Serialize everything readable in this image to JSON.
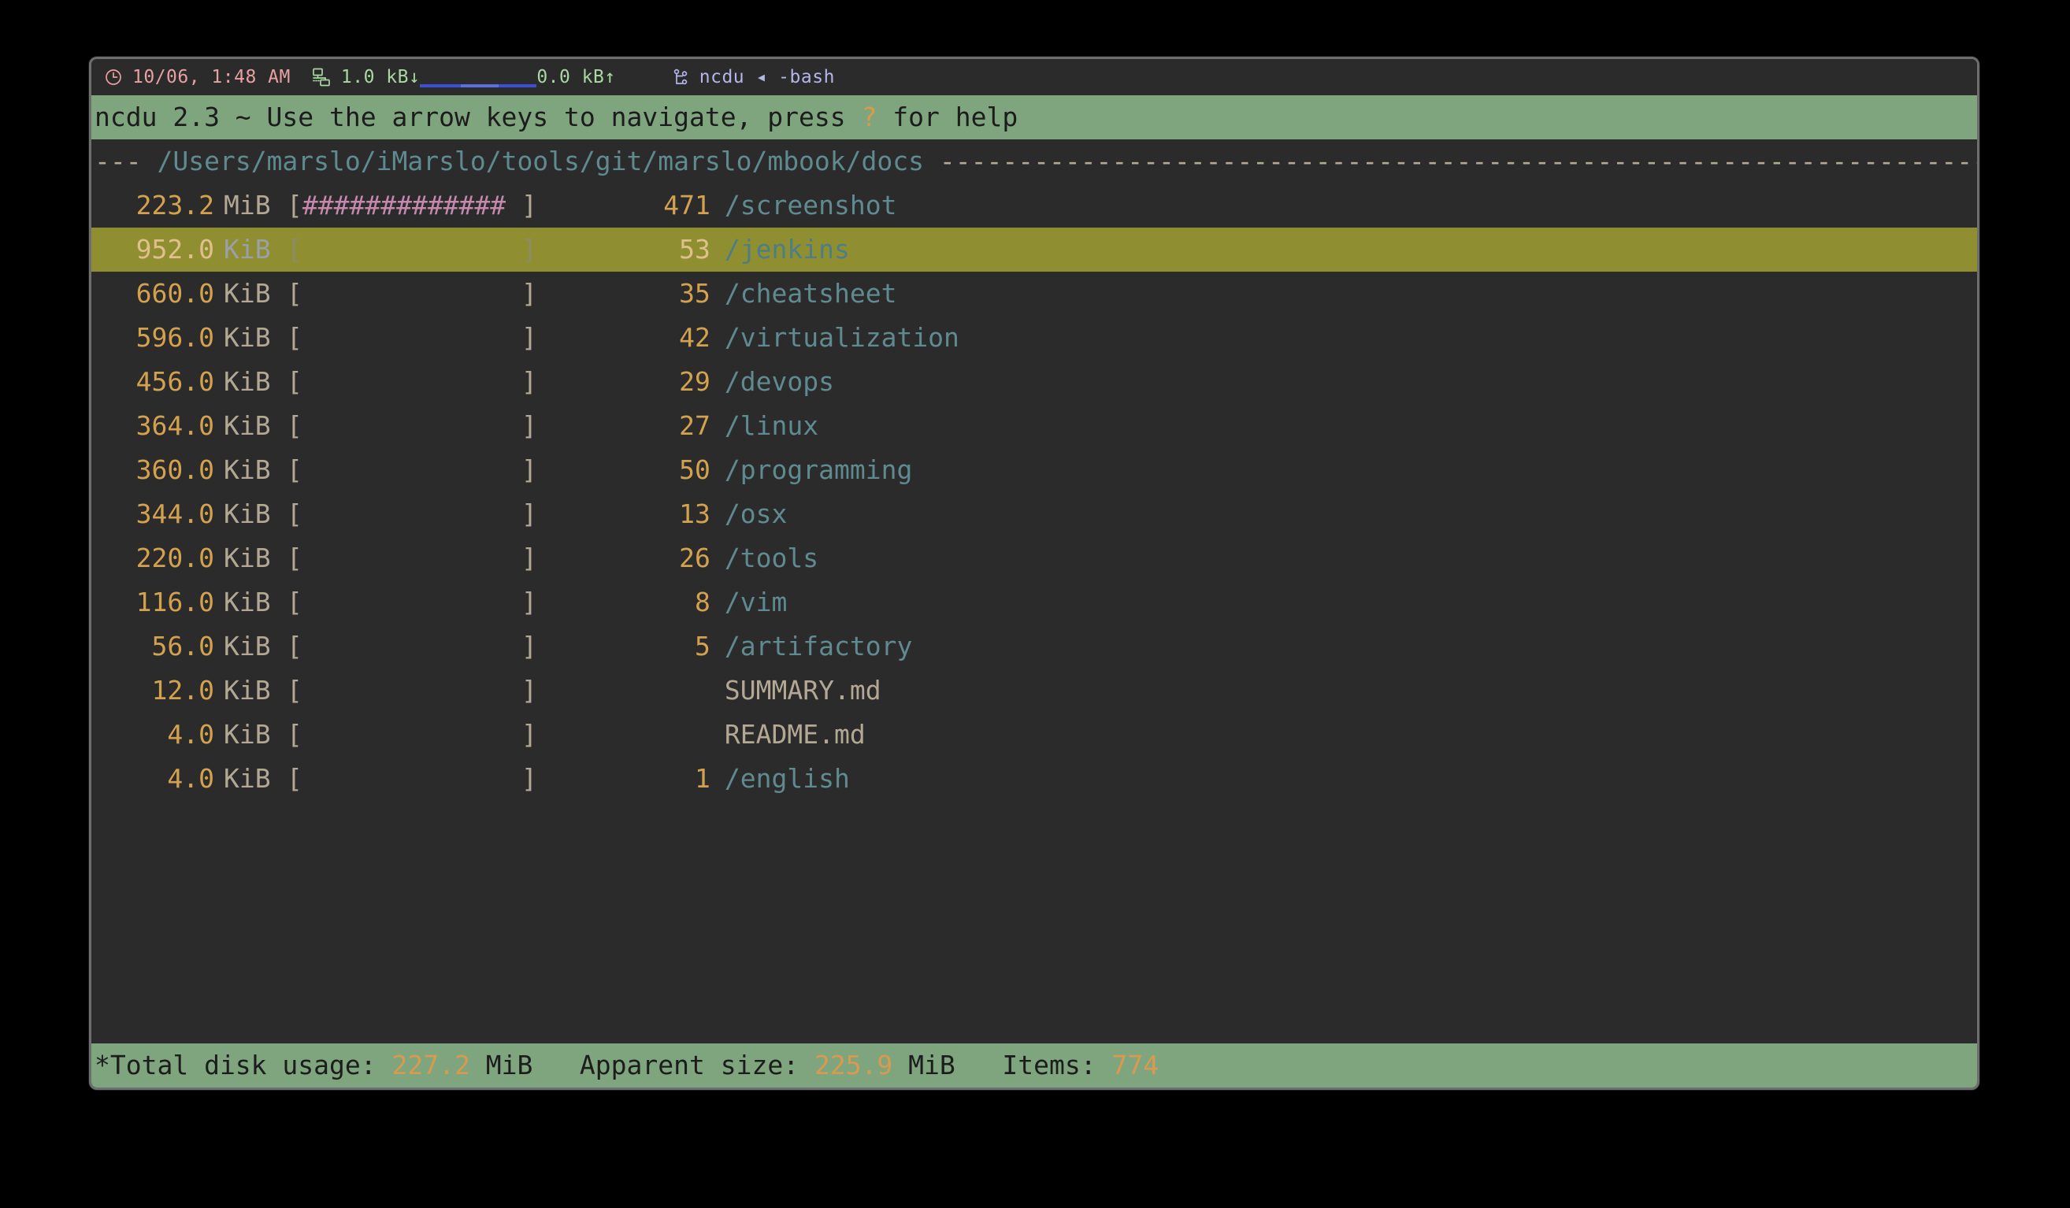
{
  "titlebar": {
    "clock_icon": "clock-icon",
    "time": "10/06, 1:48 AM",
    "network_icon": "network-icon",
    "download": "1.0 kB↓",
    "upload": "0.0 kB↑",
    "process_icon": "git-branch-icon",
    "process": "ncdu ◂ -bash"
  },
  "header": {
    "prefix": "ncdu 2.3 ~ Use the arrow keys to navigate, press ",
    "help_key": "?",
    "suffix": " for help"
  },
  "path": {
    "lead_dashes": "--- ",
    "value": "/Users/marslo/iMarslo/tools/git/marslo/mbook/docs",
    "trail_dashes": " ----------------------------------------------------------------------"
  },
  "rows": [
    {
      "size": "223.2",
      "unit": "MiB",
      "graph_filled": 13,
      "count": "471",
      "name": "/screenshot",
      "type": "dir",
      "selected": false
    },
    {
      "size": "952.0",
      "unit": "KiB",
      "graph_filled": 0,
      "count": "53",
      "name": "/jenkins",
      "type": "dir",
      "selected": true
    },
    {
      "size": "660.0",
      "unit": "KiB",
      "graph_filled": 0,
      "count": "35",
      "name": "/cheatsheet",
      "type": "dir",
      "selected": false
    },
    {
      "size": "596.0",
      "unit": "KiB",
      "graph_filled": 0,
      "count": "42",
      "name": "/virtualization",
      "type": "dir",
      "selected": false
    },
    {
      "size": "456.0",
      "unit": "KiB",
      "graph_filled": 0,
      "count": "29",
      "name": "/devops",
      "type": "dir",
      "selected": false
    },
    {
      "size": "364.0",
      "unit": "KiB",
      "graph_filled": 0,
      "count": "27",
      "name": "/linux",
      "type": "dir",
      "selected": false
    },
    {
      "size": "360.0",
      "unit": "KiB",
      "graph_filled": 0,
      "count": "50",
      "name": "/programming",
      "type": "dir",
      "selected": false
    },
    {
      "size": "344.0",
      "unit": "KiB",
      "graph_filled": 0,
      "count": "13",
      "name": "/osx",
      "type": "dir",
      "selected": false
    },
    {
      "size": "220.0",
      "unit": "KiB",
      "graph_filled": 0,
      "count": "26",
      "name": "/tools",
      "type": "dir",
      "selected": false
    },
    {
      "size": "116.0",
      "unit": "KiB",
      "graph_filled": 0,
      "count": "8",
      "name": "/vim",
      "type": "dir",
      "selected": false
    },
    {
      "size": "56.0",
      "unit": "KiB",
      "graph_filled": 0,
      "count": "5",
      "name": "/artifactory",
      "type": "dir",
      "selected": false
    },
    {
      "size": "12.0",
      "unit": "KiB",
      "graph_filled": 0,
      "count": "",
      "name": "SUMMARY.md",
      "type": "file",
      "selected": false
    },
    {
      "size": "4.0",
      "unit": "KiB",
      "graph_filled": 0,
      "count": "",
      "name": "README.md",
      "type": "file",
      "selected": false
    },
    {
      "size": "4.0",
      "unit": "KiB",
      "graph_filled": 0,
      "count": "1",
      "name": "/english",
      "type": "dir",
      "selected": false
    }
  ],
  "graph": {
    "width": 14,
    "open_bracket": "[",
    "close_bracket": "]",
    "fill_char": "#",
    "empty_char": " "
  },
  "footer": {
    "total_label": "*Total disk usage: ",
    "total_value": "227.2",
    "total_unit": " MiB",
    "apparent_label": "   Apparent size: ",
    "apparent_value": "225.9",
    "apparent_unit": " MiB",
    "items_label": "   Items: ",
    "items_value": "774"
  },
  "colors": {
    "terminal_bg": "#2b2b2b",
    "bar_green": "#7fa57f",
    "selected_olive": "#8f8f32",
    "size_amber": "#d4a24e",
    "dir_teal": "#5f8a8f",
    "file_tan": "#b3a894",
    "graph_pink": "#c489ac",
    "clock_salmon": "#e8a0a0",
    "net_green": "#a8d9a0",
    "proc_lavender": "#b5b5e8",
    "spark_blue": "#3b4fd8"
  }
}
